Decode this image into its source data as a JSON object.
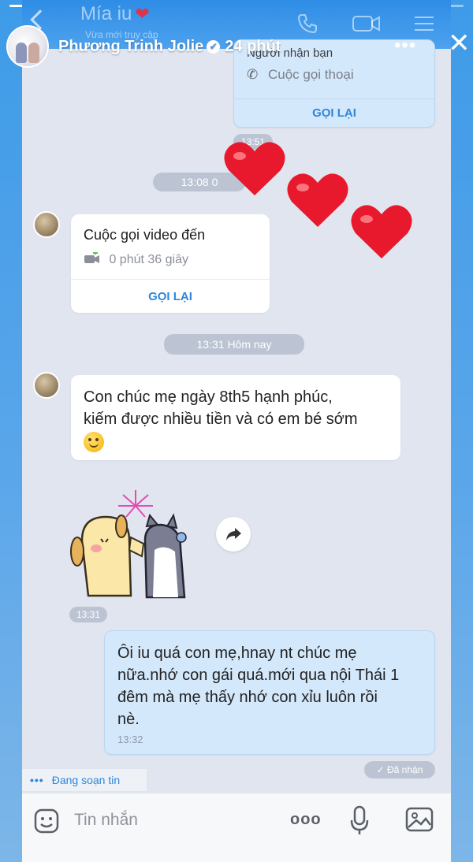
{
  "story": {
    "progress": 0.48,
    "name": "Phương Trinh Jolie",
    "verified_icon": "✔",
    "time": "24 phút",
    "more_icon": "•••",
    "close_icon": "✕"
  },
  "chat_header": {
    "contact": "Mía iu",
    "status": "Vừa mới truy cập"
  },
  "top_card": {
    "partial_title": "Người nhận bạn",
    "call_type": "Cuộc gọi thoại",
    "button": "GỌI LẠI",
    "time_partial": "13:51"
  },
  "pill_1": "13:08 0",
  "video_call": {
    "title": "Cuộc gọi video đến",
    "duration": "0 phút 36 giây",
    "button": "GỌI LẠI"
  },
  "pill_2": "13:31 Hôm nay",
  "msg_in": {
    "line1": "Con chúc mẹ ngày 8th5 hạnh phúc,",
    "line2": "kiếm được nhiều tiền và có em bé sớm"
  },
  "sticker_time": "13:31",
  "msg_out": {
    "line1": "Ôi iu quá con mẹ,hnay nt chúc mẹ",
    "line2": "nữa.nhớ con gái quá.mới qua nội Thái 1",
    "line3": "đêm mà mẹ thấy nhớ con xỉu luôn rồi",
    "line4": "nè.",
    "time": "13:32"
  },
  "seen": "✓ Đã nhận",
  "typing": "Đang soạn tin",
  "composer": {
    "placeholder": "Tin nhắn",
    "more_icon": "ooo"
  },
  "colors": {
    "accent": "#2d86d9",
    "background": "#e0e5ef",
    "heart": "#e8192c",
    "outgoing_bubble": "#d4e8fb"
  }
}
